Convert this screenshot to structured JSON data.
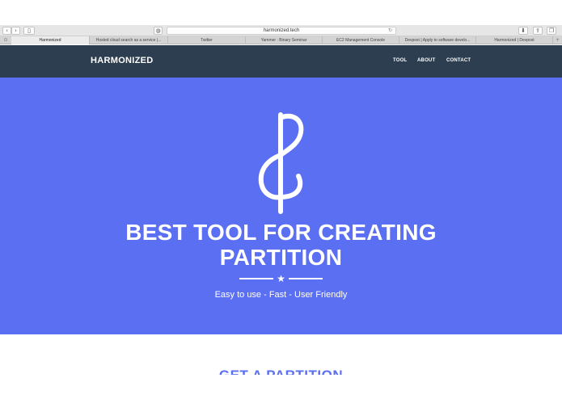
{
  "browser": {
    "url": "harmonized.tech",
    "icons": {
      "back": "chevron-left-icon",
      "forward": "chevron-right-icon",
      "sidebar": "sidebar-icon",
      "privacy": "shield-icon",
      "reload": "reload-icon",
      "downloads": "download-icon",
      "share": "share-icon",
      "tabs": "tabs-icon"
    },
    "tabs": [
      "Harmonized",
      "Hosted cloud search as a service |...",
      "Twitter",
      "Yammer : Binary Seminar",
      "EC2 Management Console",
      "Devpost | Apply to software develo...",
      "Harmonized | Devpost"
    ]
  },
  "site": {
    "brand": "HARMONIZED",
    "nav": [
      "TOOL",
      "ABOUT",
      "CONTACT"
    ],
    "hero": {
      "title_line1": "BEST TOOL FOR CREATING",
      "title_line2": "PARTITION",
      "subtitle": "Easy to use - Fast - User Friendly"
    },
    "section_title": "GET A PARTITION"
  },
  "colors": {
    "navbar": "#2c3e50",
    "hero": "#5b6ff2",
    "accent": "#5b6ff2",
    "text_on_dark": "#ffffff"
  }
}
